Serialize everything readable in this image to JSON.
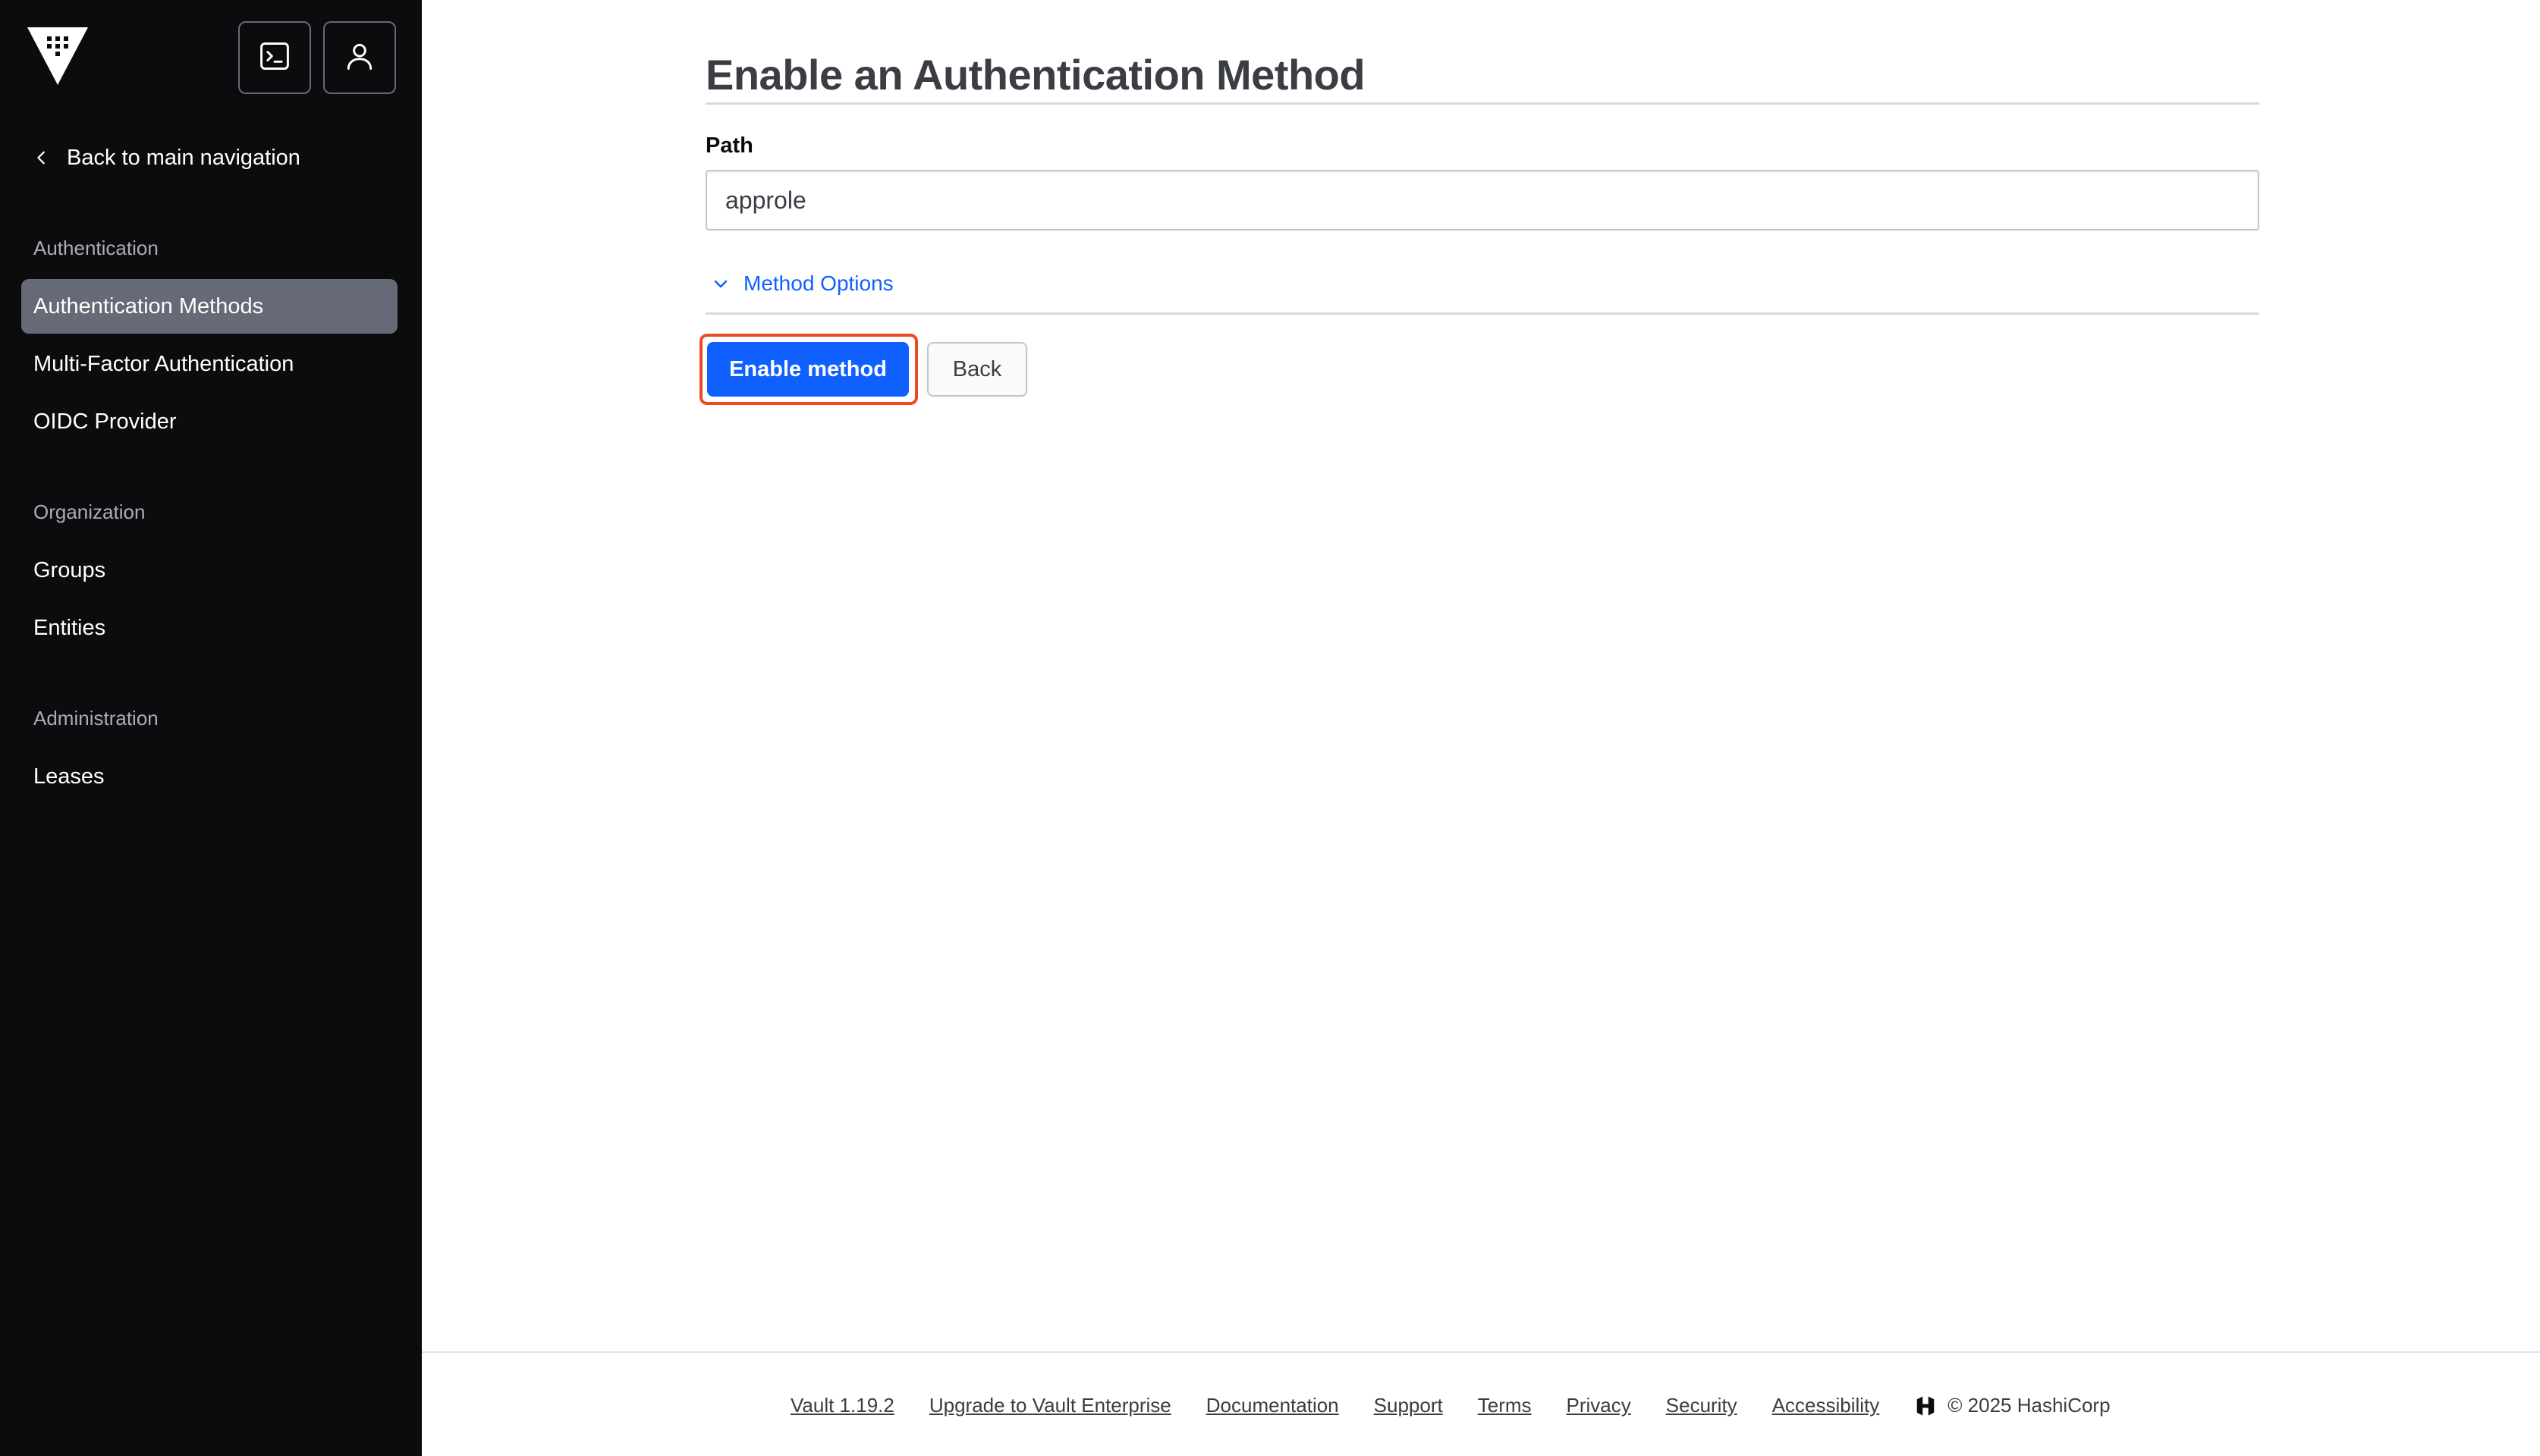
{
  "sidebar": {
    "back_label": "Back to main navigation",
    "sections": [
      {
        "title": "Authentication",
        "items": [
          "Authentication Methods",
          "Multi-Factor Authentication",
          "OIDC Provider"
        ]
      },
      {
        "title": "Organization",
        "items": [
          "Groups",
          "Entities"
        ]
      },
      {
        "title": "Administration",
        "items": [
          "Leases"
        ]
      }
    ],
    "active_item": "Authentication Methods"
  },
  "main": {
    "title": "Enable an Authentication Method",
    "path_label": "Path",
    "path_value": "approle",
    "method_options_label": "Method Options",
    "enable_button": "Enable method",
    "back_button": "Back"
  },
  "footer": {
    "links": [
      "Vault 1.19.2",
      "Upgrade to Vault Enterprise",
      "Documentation",
      "Support",
      "Terms",
      "Privacy",
      "Security",
      "Accessibility"
    ],
    "copyright": "© 2025 HashiCorp"
  },
  "colors": {
    "sidebar_bg": "#0c0c0e",
    "active_item_bg": "#656a76",
    "primary": "#1060ff",
    "focus_ring": "#ec4a24"
  },
  "icons": [
    "vault-logo-icon",
    "terminal-icon",
    "user-icon",
    "chevron-left-icon",
    "chevron-down-icon",
    "hashicorp-logo-icon"
  ]
}
